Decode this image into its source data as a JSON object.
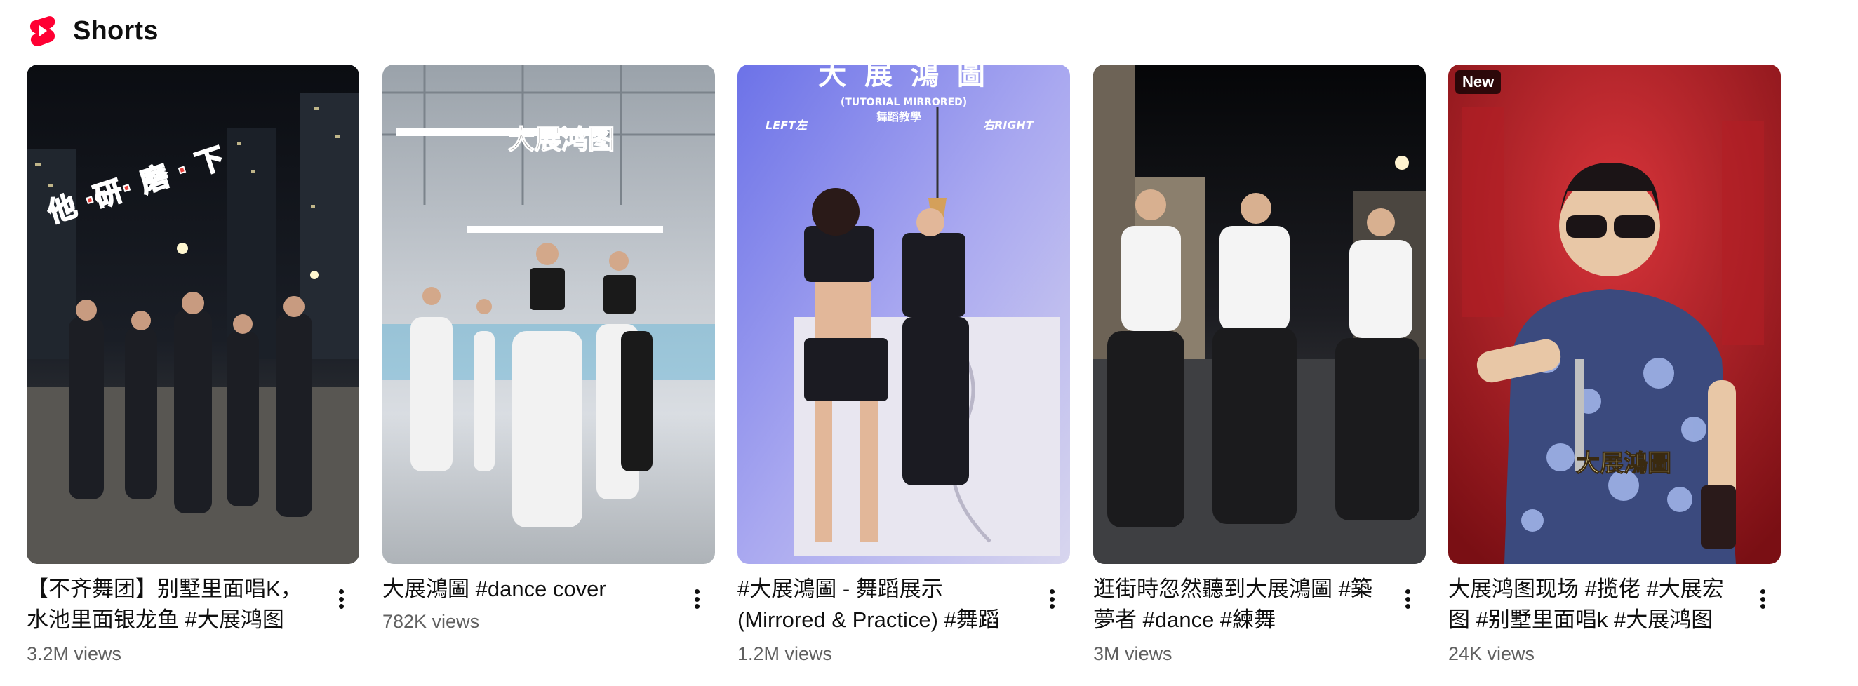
{
  "shelf": {
    "title": "Shorts",
    "logo_icon": "youtube-shorts-icon",
    "brand_color": "#ff0033"
  },
  "items": [
    {
      "title": "【不齐舞团】别墅里面唱K，水池里面银龙鱼 #大展鸿图",
      "views": "3.2M views",
      "overlay_text": "他 ·研· 磨 · 下",
      "badge": ""
    },
    {
      "title": "大展鴻圖 #dance cover",
      "views": "782K views",
      "overlay_text": "大展鸿图",
      "badge": ""
    },
    {
      "title": "#大展鴻圖 - 舞蹈展示 (Mirrored & Practice) #舞蹈",
      "views": "1.2M views",
      "overlay_text": "大 展 鴻 圖",
      "overlay_sub": "(TUTORIAL MIRRORED)",
      "overlay_sub2": "舞蹈教學",
      "overlay_left": "LEFT左",
      "overlay_right": "右RIGHT",
      "badge": ""
    },
    {
      "title": "逛街時忽然聽到大展鴻圖 #築夢者 #dance #練舞",
      "views": "3M views",
      "badge": ""
    },
    {
      "title": "大展鸿图现场 #揽佬 #大展宏图 #别墅里面唱k #大展鸿图",
      "views": "24K views",
      "overlay_text": "大展鴻圖",
      "badge": "New"
    }
  ]
}
